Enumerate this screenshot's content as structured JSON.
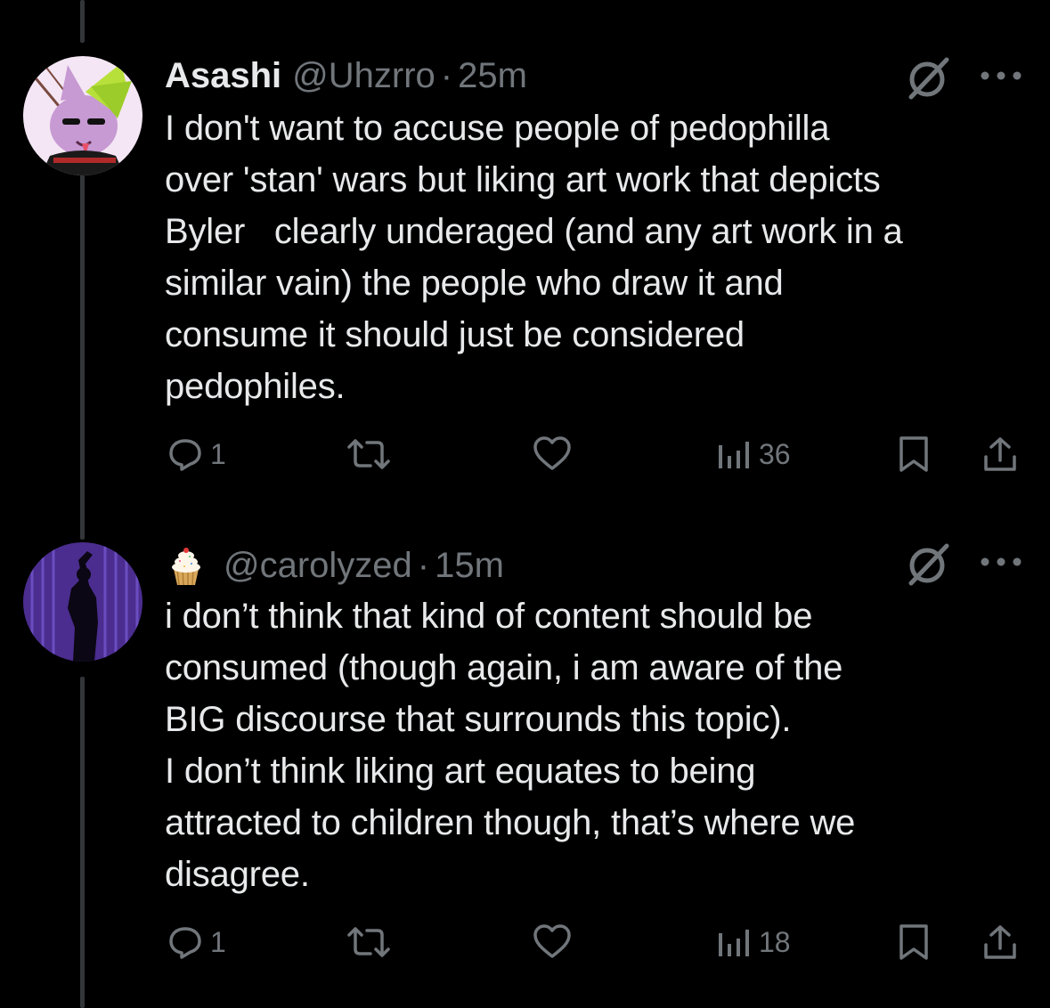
{
  "tweets": [
    {
      "display_name": "Asashi",
      "handle": "@Uhzrro",
      "separator": "·",
      "time": "25m",
      "text": "I don't want to accuse people of pedophilla\nover 'stan' wars but liking art work that depicts\nByler   clearly underaged (and any art work in a\nsimilar vain) the people who draw it and\nconsume it should just be considered\npedophiles.",
      "replies": "1",
      "views": "36",
      "avatar_icon": "anthro-character-avatar",
      "colors": {
        "avatar_bg": "#f4e6f4",
        "hair": "#b8e03a",
        "fur": "#c79ad3"
      }
    },
    {
      "display_name": "",
      "name_emoji": "cupcake-icon",
      "handle": "@carolyzed",
      "separator": "·",
      "time": "15m",
      "text": "i don’t think that kind of content should be\nconsumed (though again, i am aware of the\nBIG discourse that surrounds this topic).\nI don’t think liking art equates to being\nattracted to children though, that’s where we\ndisagree.",
      "replies": "1",
      "views": "18",
      "avatar_icon": "concert-silhouette-avatar",
      "colors": {
        "avatar_bg": "#4b2d8f",
        "accent": "#7a5cd6"
      }
    }
  ],
  "colors": {
    "background": "#000000",
    "text": "#e7e9ea",
    "muted": "#71767b",
    "thread_line": "#333639"
  }
}
